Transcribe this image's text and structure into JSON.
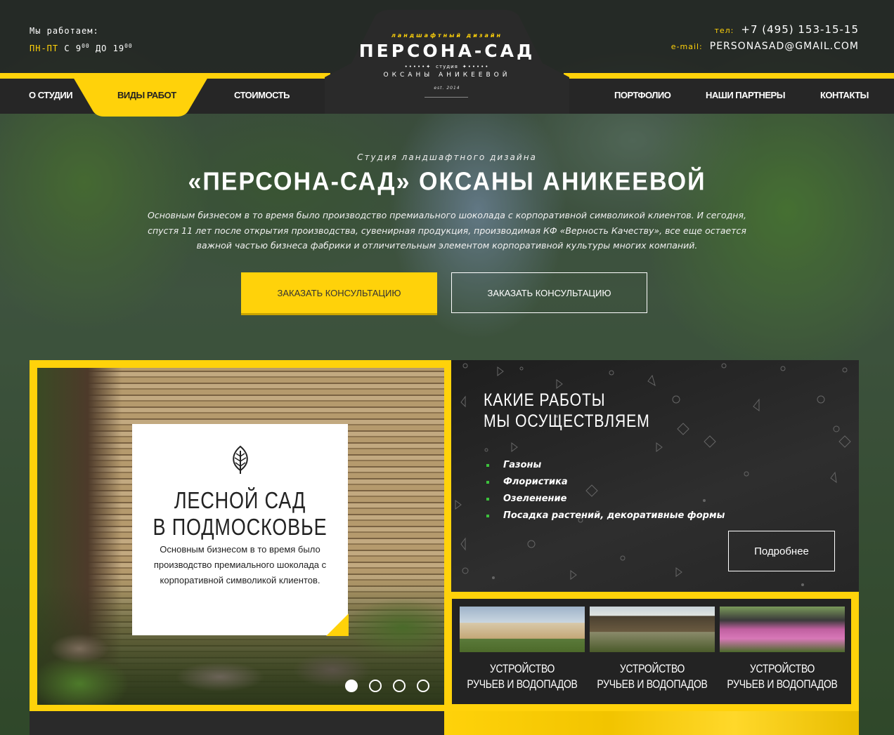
{
  "header": {
    "hours_label": "Мы работаем:",
    "hours_days": "ПН-ПТ",
    "hours_from_word": "С",
    "hours_from": "9",
    "hours_from_sup": "00",
    "hours_to_word": "ДО",
    "hours_to": "19",
    "hours_to_sup": "00",
    "phone_label": "тел:",
    "phone": "+7 (495) 153-15-15",
    "email_label": "e-mail:",
    "email": "PERSONASAD@GMAIL.COM"
  },
  "logo": {
    "subtitle": "ландшафтный дизайн",
    "title": "ПЕРСОНА-САД",
    "studio": "студия",
    "name": "ОКСАНЫ АНИКЕЕВОЙ",
    "est": "est. 2014"
  },
  "nav": {
    "items": [
      {
        "label": "О СТУДИИ"
      },
      {
        "label": "ВИДЫ РАБОТ"
      },
      {
        "label": "СТОИМОСТЬ"
      },
      {
        "label": "ПОРТФОЛИО"
      },
      {
        "label": "НАШИ ПАРТНЕРЫ"
      },
      {
        "label": "КОНТАКТЫ"
      }
    ]
  },
  "hero": {
    "kicker": "Студия ландшафтного дизайна",
    "title": "«ПЕРСОНА-САД» ОКСАНЫ АНИКЕЕВОЙ",
    "text": "Основным бизнесом в то время было производство премиального шоколада с корпоративной символикой клиентов. И сегодня, спустя 11 лет после открытия производства, сувенирная продукция, производимая КФ «Верность Качеству», все еще остается важной частью бизнеса фабрики и отличительным элементом корпоративной культуры многих компаний.",
    "btn_primary": "ЗАКАЗАТЬ КОНСУЛЬТАЦИЮ",
    "btn_outline": "ЗАКАЗАТЬ КОНСУЛЬТАЦИЮ"
  },
  "feature": {
    "title_line1": "ЛЕСНОЙ САД",
    "title_line2": "В ПОДМОСКОВЬЕ",
    "text": "Основным бизнесом в то время было производство премиального шоколада с корпоративной символикой клиентов.",
    "slides": 4,
    "active_slide": 1
  },
  "services": {
    "title_line1": "КАКИЕ РАБОТЫ",
    "title_line2": "МЫ ОСУЩЕСТВЛЯЕМ",
    "items": [
      "Газоны",
      "Флористика",
      "Озеленение",
      "Посадка растений, декоративные формы"
    ],
    "more": "Подробнее",
    "bullet_color": "#3cc23c"
  },
  "thumbs": [
    {
      "line1": "УСТРОЙСТВО",
      "line2": "РУЧЬЕВ И ВОДОПАДОВ"
    },
    {
      "line1": "УСТРОЙСТВО",
      "line2": "РУЧЬЕВ И ВОДОПАДОВ"
    },
    {
      "line1": "УСТРОЙСТВО",
      "line2": "РУЧЬЕВ И ВОДОПАДОВ"
    }
  ],
  "colors": {
    "accent": "#ffd20a",
    "dark": "#262626"
  }
}
